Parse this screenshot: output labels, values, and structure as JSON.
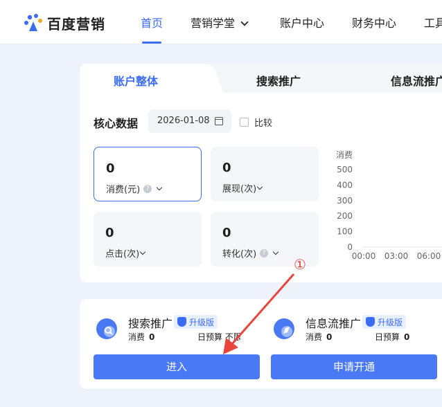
{
  "brand": {
    "name": "百度营销"
  },
  "nav": {
    "items": [
      {
        "label": "首页"
      },
      {
        "label": "营销学堂"
      },
      {
        "label": "账户中心"
      },
      {
        "label": "财务中心"
      },
      {
        "label": "工具"
      }
    ]
  },
  "tabs": [
    {
      "label": "账户整体"
    },
    {
      "label": "搜索推广"
    },
    {
      "label": "信息流推广"
    }
  ],
  "core": {
    "title": "核心数据",
    "date": "2026-01-08",
    "compare_label": "比较"
  },
  "metrics": [
    {
      "value": "0",
      "label": "消费(元)"
    },
    {
      "value": "0",
      "label": "展现(次)"
    },
    {
      "value": "0",
      "label": "点击(次)"
    },
    {
      "value": "0",
      "label": "转化(次)"
    }
  ],
  "chart_data": {
    "type": "line",
    "ylabel": "消费",
    "ylim": [
      0,
      500
    ],
    "yticks": [
      "500",
      "400",
      "300",
      "200",
      "100",
      "0"
    ],
    "categories": [
      "00:00",
      "03:00",
      "06:00"
    ],
    "series": [
      {
        "values": [
          0,
          0,
          0
        ]
      }
    ]
  },
  "products": [
    {
      "name": "搜索推广",
      "badge": "升级版",
      "spend_label": "消费",
      "spend_value": "0",
      "budget_label": "日预算",
      "budget_value": "不限",
      "button": "进入"
    },
    {
      "name": "信息流推广",
      "badge": "升级版",
      "spend_label": "消费",
      "spend_value": "0",
      "budget_label": "日预算",
      "budget_value": "0",
      "button": "申请开通"
    }
  ],
  "annotation": {
    "marker": "①"
  },
  "colors": {
    "accent": "#3b6cf6",
    "button": "#4a79f5",
    "arrow": "#e8453c"
  }
}
